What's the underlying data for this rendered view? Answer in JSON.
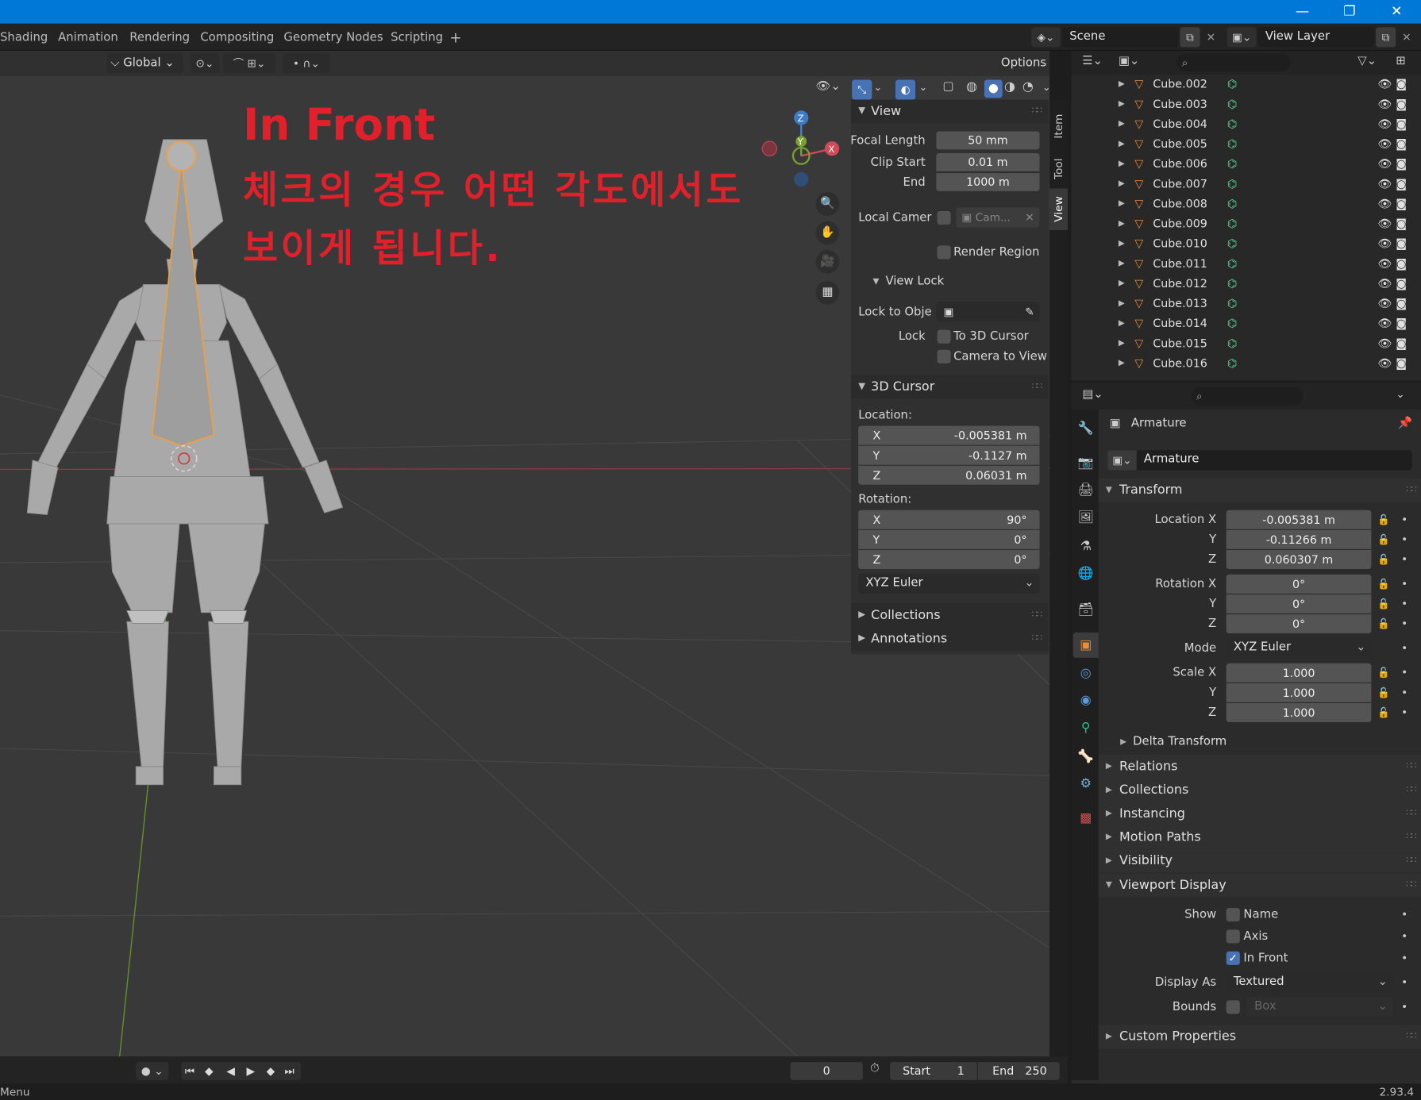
{
  "window_controls": {
    "minimize": "—",
    "maximize": "❐",
    "close": "✕"
  },
  "workspace_tabs": [
    "Shading",
    "Animation",
    "Rendering",
    "Compositing",
    "Geometry Nodes",
    "Scripting"
  ],
  "add_tab": "+",
  "scene": {
    "name": "Scene"
  },
  "view_layer": {
    "name": "View Layer"
  },
  "viewport_header": {
    "orientation": "Global",
    "options_label": "Options"
  },
  "annotation": {
    "title": "In Front",
    "line1": "체크의 경우 어떤 각도에서도",
    "line2": "보이게 됩니다.",
    "color": "#e0202a"
  },
  "gizmo": {
    "z": "Z",
    "y": "Y",
    "x": "X"
  },
  "npanel": {
    "tabs": [
      "Item",
      "Tool",
      "View"
    ],
    "view": {
      "title": "View",
      "focal_length_label": "Focal Length",
      "focal_length": "50 mm",
      "clip_start_label": "Clip Start",
      "clip_start": "0.01 m",
      "end_label": "End",
      "end": "1000 m",
      "local_camera_label": "Local Camer",
      "local_camera_value": "Cam...",
      "render_region_label": "Render Region"
    },
    "view_lock": {
      "title": "View Lock",
      "lock_to_object_label": "Lock to Obje",
      "lock_label": "Lock",
      "to_3d_cursor": "To 3D Cursor",
      "camera_to_view": "Camera to View"
    },
    "cursor": {
      "title": "3D Cursor",
      "location_label": "Location:",
      "loc": [
        {
          "axis": "X",
          "value": "-0.005381 m"
        },
        {
          "axis": "Y",
          "value": "-0.1127 m"
        },
        {
          "axis": "Z",
          "value": "0.06031 m"
        }
      ],
      "rotation_label": "Rotation:",
      "rot": [
        {
          "axis": "X",
          "value": "90°"
        },
        {
          "axis": "Y",
          "value": "0°"
        },
        {
          "axis": "Z",
          "value": "0°"
        }
      ],
      "mode": "XYZ Euler"
    },
    "collections": "Collections",
    "annotations": "Annotations"
  },
  "outliner": {
    "items": [
      "Cube.002",
      "Cube.003",
      "Cube.004",
      "Cube.005",
      "Cube.006",
      "Cube.007",
      "Cube.008",
      "Cube.009",
      "Cube.010",
      "Cube.011",
      "Cube.012",
      "Cube.013",
      "Cube.014",
      "Cube.015",
      "Cube.016"
    ]
  },
  "properties": {
    "object_name": "Armature",
    "data_name": "Armature",
    "transform": {
      "title": "Transform",
      "location_x_label": "Location X",
      "location": [
        "-0.005381 m",
        "-0.11266 m",
        "0.060307 m"
      ],
      "rotation_x_label": "Rotation X",
      "rotation": [
        "0°",
        "0°",
        "0°"
      ],
      "mode_label": "Mode",
      "mode": "XYZ Euler",
      "scale_x_label": "Scale X",
      "scale": [
        "1.000",
        "1.000",
        "1.000"
      ],
      "y_label": "Y",
      "z_label": "Z",
      "delta": "Delta Transform"
    },
    "sections": [
      "Relations",
      "Collections",
      "Instancing",
      "Motion Paths",
      "Visibility"
    ],
    "viewport_display": {
      "title": "Viewport Display",
      "show_label": "Show",
      "name": "Name",
      "axis": "Axis",
      "in_front": "In Front",
      "in_front_checked": true,
      "display_as_label": "Display As",
      "display_as": "Textured",
      "bounds_label": "Bounds",
      "bounds_value": "Box"
    },
    "custom_properties": "Custom Properties"
  },
  "timeline": {
    "frame": "0",
    "start_label": "Start",
    "start": "1",
    "end_label": "End",
    "end": "250"
  },
  "status": {
    "left": "Menu",
    "version": "2.93.4"
  }
}
